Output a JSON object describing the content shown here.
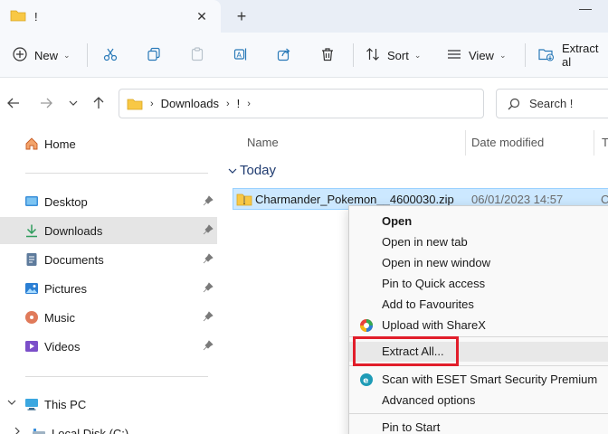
{
  "tab": {
    "title": "!",
    "close_glyph": "✕",
    "new_glyph": "+"
  },
  "toolbar": {
    "new_label": "New",
    "sort_label": "Sort",
    "view_label": "View",
    "extract_label": "Extract al"
  },
  "address": {
    "crumbs": [
      "Downloads",
      "!"
    ],
    "search_placeholder": "Search !"
  },
  "sidebar": {
    "home": "Home",
    "items": [
      {
        "label": "Desktop"
      },
      {
        "label": "Downloads"
      },
      {
        "label": "Documents"
      },
      {
        "label": "Pictures"
      },
      {
        "label": "Music"
      },
      {
        "label": "Videos"
      }
    ],
    "this_pc": "This PC",
    "local_disk": "Local Disk (C:)"
  },
  "main": {
    "columns": [
      "Name",
      "Date modified",
      "T"
    ],
    "group": "Today",
    "file": {
      "name": "Charmander_Pokemon__4600030.zip",
      "date": "06/01/2023 14:57",
      "type": "C"
    }
  },
  "context_menu": {
    "items": [
      "Open",
      "Open in new tab",
      "Open in new window",
      "Pin to Quick access",
      "Add to Favourites",
      "Upload with ShareX",
      "Extract All...",
      "Scan with ESET Smart Security Premium",
      "Advanced options",
      "Pin to Start"
    ]
  },
  "colors": {
    "accent": "#0067c0",
    "highlight_box": "#e11d2a",
    "selection": "#cce8ff",
    "folder": "#f8c845"
  }
}
